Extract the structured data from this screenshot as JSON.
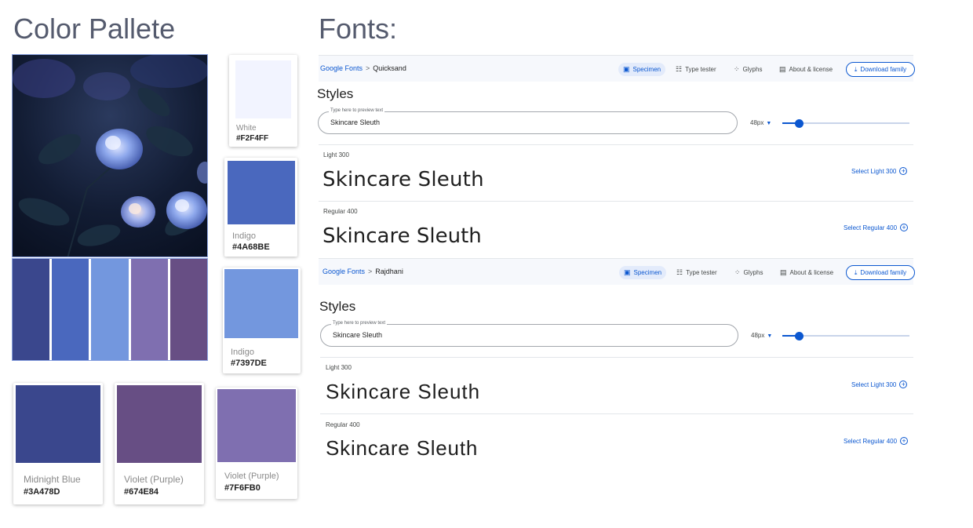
{
  "palette": {
    "heading": "Color Pallete",
    "strip_colors": [
      "#3A478D",
      "#4A68BE",
      "#7397DE",
      "#7F6FB0",
      "#674E84"
    ],
    "swatches": [
      {
        "name": "White",
        "hex": "#F2F4FF",
        "color": "#F2F4FF"
      },
      {
        "name": "Indigo",
        "hex": "#4A68BE",
        "color": "#4A68BE"
      },
      {
        "name": "Indigo",
        "hex": "#7397DE",
        "color": "#7397DE"
      },
      {
        "name": "Midnight Blue",
        "hex": "#3A478D",
        "color": "#3A478D"
      },
      {
        "name": "Violet (Purple)",
        "hex": "#674E84",
        "color": "#674E84"
      },
      {
        "name": "Violet (Purple)",
        "hex": "#7F6FB0",
        "color": "#7F6FB0"
      }
    ]
  },
  "fonts": {
    "heading": "Fonts:",
    "nav": {
      "specimen": "Specimen",
      "type_tester": "Type tester",
      "glyphs": "Glyphs",
      "about": "About & license",
      "download": "Download family"
    },
    "panels": [
      {
        "breadcrumb_root": "Google Fonts",
        "breadcrumb_sep": ">",
        "font_name": "Quicksand",
        "styles_title": "Styles",
        "preview_label": "Type here to preview text",
        "preview_value": "Skincare Sleuth",
        "size": "48px",
        "rows": [
          {
            "label": "Light 300",
            "sample": "Skincare Sleuth",
            "select": "Select Light 300"
          },
          {
            "label": "Regular 400",
            "sample": "Skincare Sleuth",
            "select": "Select Regular 400"
          }
        ]
      },
      {
        "breadcrumb_root": "Google Fonts",
        "breadcrumb_sep": ">",
        "font_name": "Rajdhani",
        "styles_title": "Styles",
        "preview_label": "Type here to preview text",
        "preview_value": "Skincare Sleuth",
        "size": "48px",
        "rows": [
          {
            "label": "Light 300",
            "sample": "Skincare Sleuth",
            "select": "Select Light 300"
          },
          {
            "label": "Regular 400",
            "sample": "Skincare Sleuth",
            "select": "Select Regular 400"
          }
        ]
      }
    ]
  }
}
